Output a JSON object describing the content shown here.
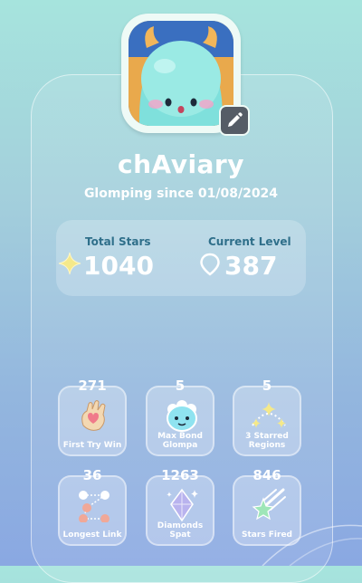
{
  "profile": {
    "username": "chAviary",
    "since_text": "Glomping since 01/08/2024"
  },
  "stats": {
    "total_stars_label": "Total Stars",
    "total_stars_value": "1040",
    "current_level_label": "Current Level",
    "current_level_value": "387"
  },
  "achievements": [
    {
      "count": "271",
      "label_line1": "First Try Win",
      "label_line2": "",
      "icon": "hand-heart-icon"
    },
    {
      "count": "5",
      "label_line1": "Max Bond",
      "label_line2": "Glompa",
      "icon": "glompa-face-icon"
    },
    {
      "count": "5",
      "label_line1": "3 Starred",
      "label_line2": "Regions",
      "icon": "three-stars-icon"
    },
    {
      "count": "36",
      "label_line1": "Longest Link",
      "label_line2": "",
      "icon": "link-dots-icon"
    },
    {
      "count": "1263",
      "label_line1": "Diamonds",
      "label_line2": "Spat",
      "icon": "diamond-icon"
    },
    {
      "count": "846",
      "label_line1": "Stars Fired",
      "label_line2": "",
      "icon": "shooting-star-icon"
    }
  ],
  "colors": {
    "background_top": "#a6e4dd",
    "background_bottom": "#8aa8e2",
    "label_teal": "#2f6f8a",
    "star_yellow": "#f5e98a",
    "avatar_creature": "#7fe0dc"
  }
}
